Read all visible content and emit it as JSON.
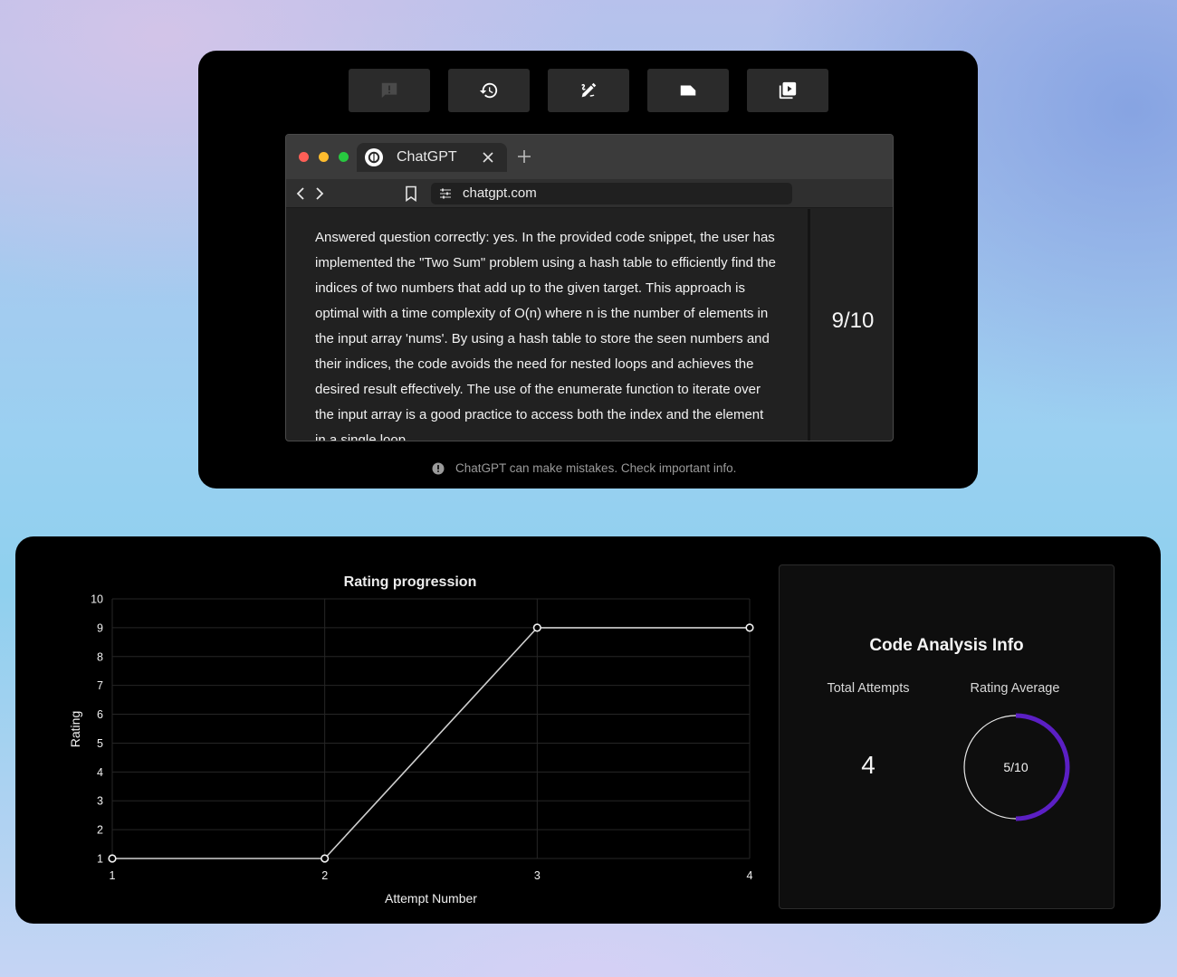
{
  "toolbar": {
    "buttons": [
      {
        "icon": "feedback-icon"
      },
      {
        "icon": "history-icon"
      },
      {
        "icon": "edit-icon"
      },
      {
        "icon": "label-icon"
      },
      {
        "icon": "video-library-icon"
      }
    ]
  },
  "browser": {
    "tab_title": "ChatGPT",
    "url": "chatgpt.com"
  },
  "response": {
    "answer_text": "Answered question correctly: yes. In the provided code snippet, the user has implemented the \"Two Sum\" problem using a hash table to efficiently find the indices of two numbers that add up to the given target. This approach is optimal with a time complexity of O(n) where n is the number of elements in the input array 'nums'. By using a hash table to store the seen numbers and their indices, the code avoids the need for nested loops and achieves the desired result effectively. The use of the enumerate function to iterate over the input array is a good practice to access both the index and the element in a single loop.",
    "score": "9/10"
  },
  "disclaimer": "ChatGPT can make mistakes. Check important info.",
  "chart_data": {
    "type": "line",
    "title": "Rating progression",
    "xlabel": "Attempt Number",
    "ylabel": "Rating",
    "x": [
      1,
      2,
      3,
      4
    ],
    "y": [
      1,
      1,
      9,
      9
    ],
    "xlim": [
      1,
      4
    ],
    "ylim": [
      1,
      10
    ],
    "xticks": [
      "1",
      "2",
      "3",
      "4"
    ],
    "yticks": [
      "1",
      "2",
      "3",
      "4",
      "5",
      "6",
      "7",
      "8",
      "9",
      "10"
    ],
    "grid": true,
    "line_color": "#cfcfcf"
  },
  "info": {
    "title": "Code Analysis Info",
    "total_attempts_label": "Total Attempts",
    "total_attempts_value": "4",
    "rating_average_label": "Rating Average",
    "rating_average_text": "5/10",
    "rating_average_fraction": 0.5,
    "gauge_color": "#5b1fc4"
  }
}
